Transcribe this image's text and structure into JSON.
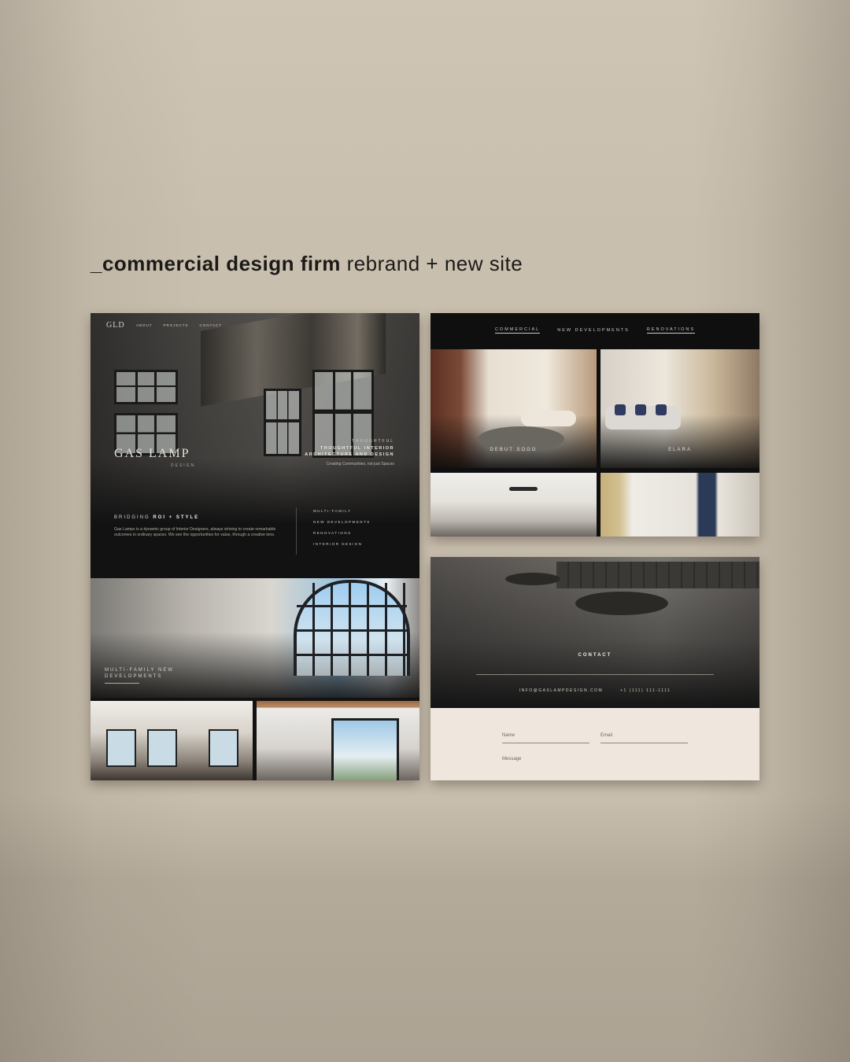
{
  "headline": {
    "bold": "_commercial design firm",
    "light": " rebrand + new site"
  },
  "home_page": {
    "logo": "GLD",
    "nav": [
      "ABOUT",
      "PROJECTS",
      "CONTACT"
    ],
    "brand_name": "GAS LAMP",
    "brand_sub": "DESIGN.",
    "tagline_small": "THOUGHTFUL",
    "tagline_main": "THOUGHTFUL INTERIOR ARCHITECTURE AND DESIGN",
    "tagline_sub": "Creating Communities, not just Spaces",
    "bridging_prefix": "BRIDGING ",
    "bridging_bold": "ROI + STYLE",
    "bridging_body": "Gas Lamps is a dynamic group of Interior Designers, always striving to create remarkable outcomes in ordinary spaces. We see the opportunities for value, through a creative lens.",
    "services": [
      "MULTI-FAMILY",
      "NEW DEVELOPMENTS",
      "RENOVATIONS",
      "INTERIOR DESIGN"
    ],
    "feature_label": "MULTI-FAMILY NEW DEVELOPMENTS"
  },
  "projects_page": {
    "nav": [
      {
        "label": "COMMERCIAL",
        "underlined": true
      },
      {
        "label": "NEW DEVELOPMENTS",
        "underlined": false
      },
      {
        "label": "RENOVATIONS",
        "underlined": true
      }
    ],
    "projects": [
      "DEBUT SOGO",
      "ELARA"
    ]
  },
  "contact_page": {
    "title": "CONTACT",
    "email": "INFO@GASLAMPDESIGN.COM",
    "phone": "+1 (111) 111-1111",
    "form": {
      "name_label": "Name",
      "email_label": "Email",
      "message_label": "Message"
    }
  },
  "colors": {
    "background": "#c9bfae",
    "panel_dark": "#121212",
    "form_bg": "#efe7de",
    "accent": "#c9a876"
  }
}
